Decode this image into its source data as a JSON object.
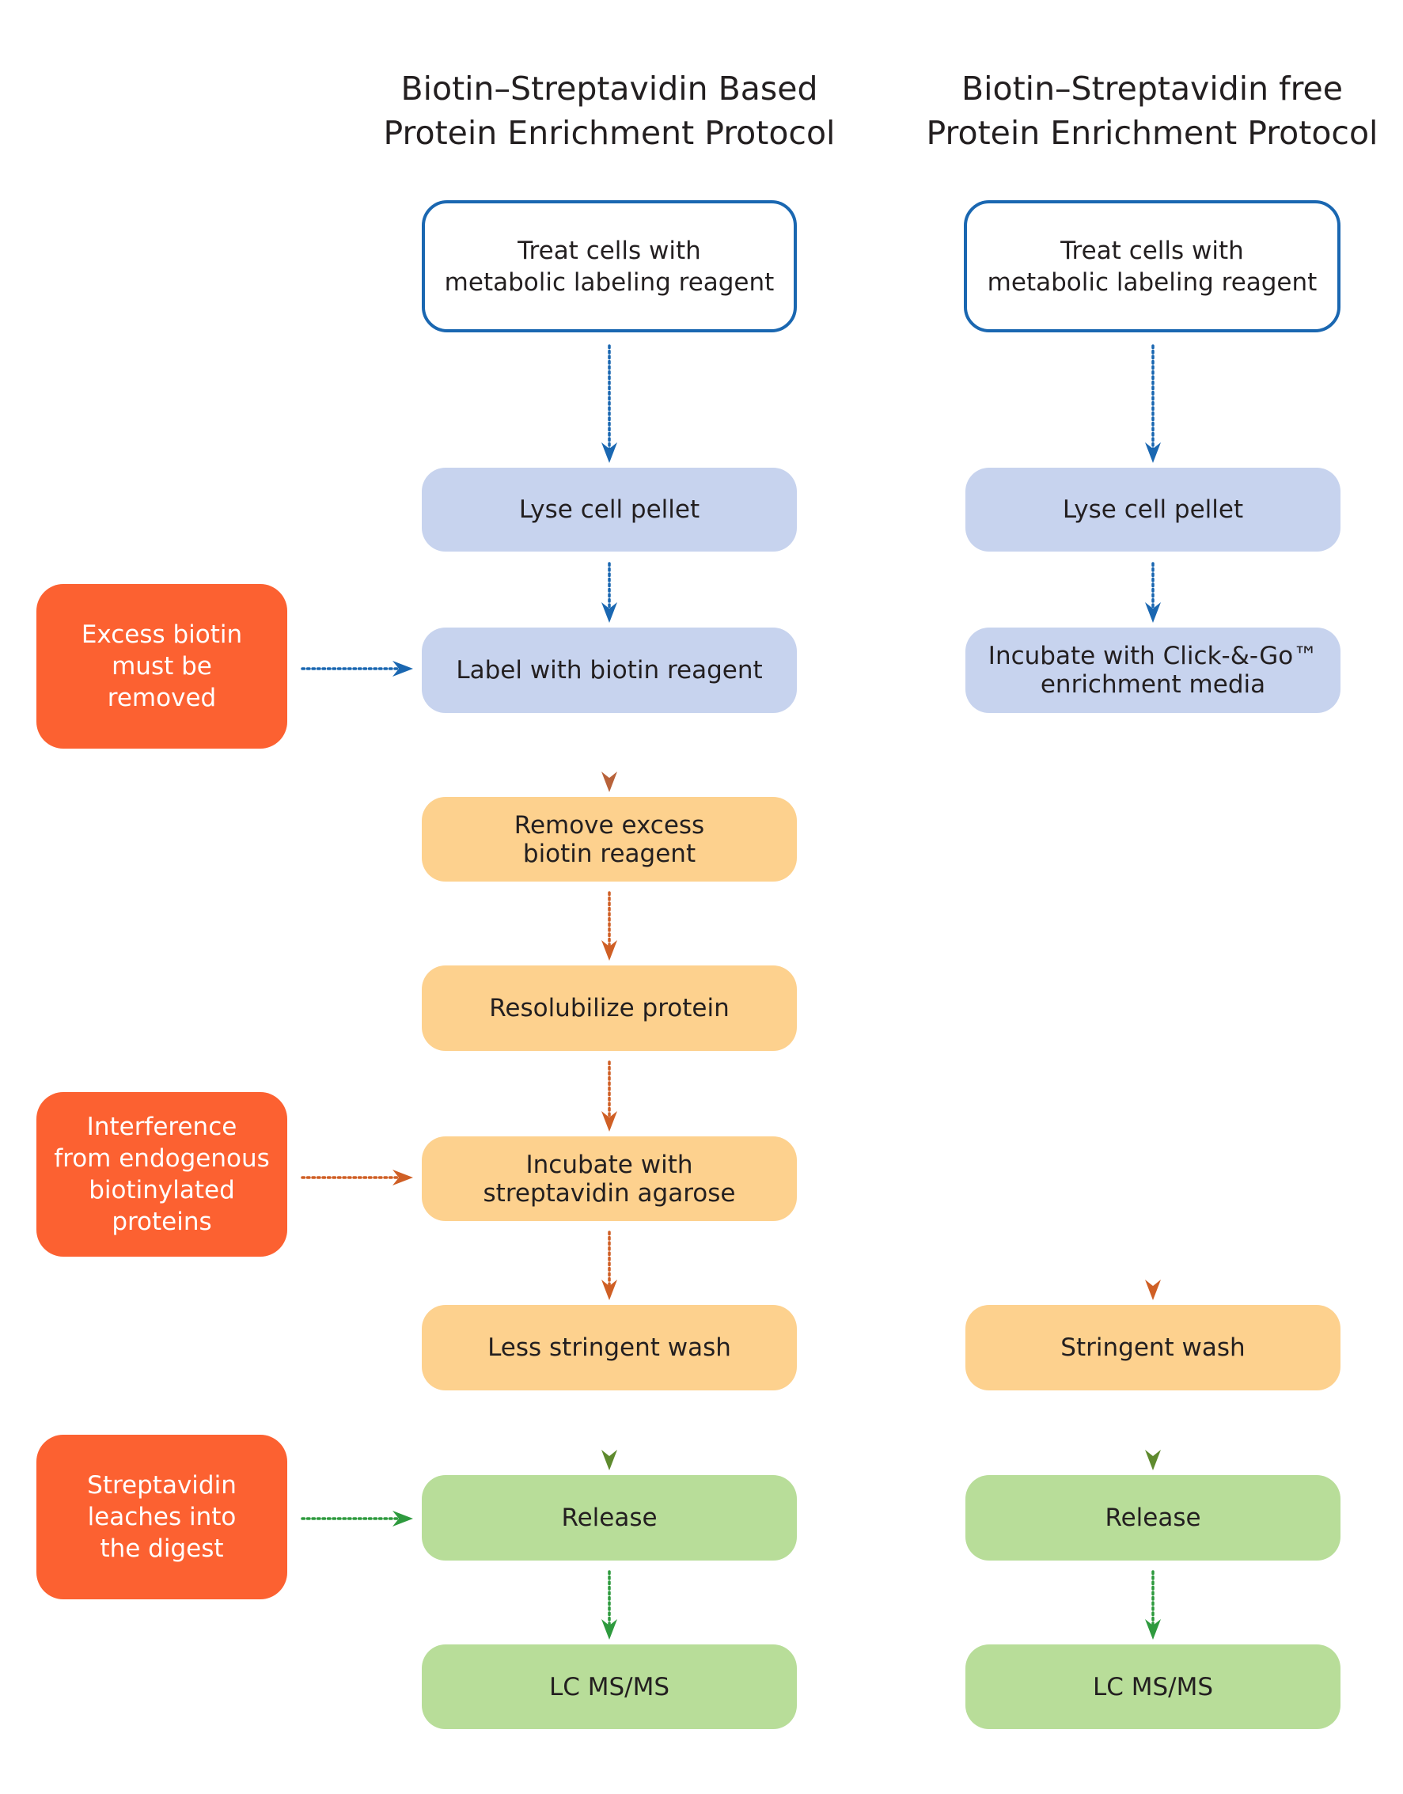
{
  "columns": [
    {
      "title": [
        "Biotin–Streptavidin Based",
        "Protein Enrichment Protocol"
      ],
      "steps": [
        {
          "lines": [
            "Treat cells with",
            "metabolic labeling reagent"
          ],
          "style": "outline"
        },
        {
          "lines": [
            "Lyse cell pellet"
          ],
          "style": "blue"
        },
        {
          "lines": [
            "Label with biotin reagent"
          ],
          "style": "blue"
        },
        {
          "lines": [
            "Remove excess",
            "biotin reagent"
          ],
          "style": "amber"
        },
        {
          "lines": [
            "Resolubilize protein"
          ],
          "style": "amber"
        },
        {
          "lines": [
            "Incubate with",
            "streptavidin agarose"
          ],
          "style": "amber"
        },
        {
          "lines": [
            "Less stringent wash"
          ],
          "style": "amber"
        },
        {
          "lines": [
            "Release"
          ],
          "style": "green"
        },
        {
          "lines": [
            "LC MS/MS"
          ],
          "style": "green"
        }
      ]
    },
    {
      "title": [
        "Biotin–Streptavidin free",
        "Protein Enrichment Protocol"
      ],
      "steps": [
        {
          "lines": [
            "Treat cells with",
            "metabolic labeling reagent"
          ],
          "style": "outline"
        },
        {
          "lines": [
            "Lyse cell pellet"
          ],
          "style": "blue"
        },
        {
          "lines": [
            "Incubate with Click-&-Go™",
            "enrichment media"
          ],
          "style": "blue"
        },
        {
          "lines": [
            "Stringent wash"
          ],
          "style": "amber"
        },
        {
          "lines": [
            "Release"
          ],
          "style": "green"
        },
        {
          "lines": [
            "LC MS/MS"
          ],
          "style": "green"
        }
      ]
    }
  ],
  "callouts": [
    {
      "lines": [
        "Excess biotin",
        "must  be",
        "removed"
      ],
      "points_to": "Label with biotin reagent",
      "arrow_color": "#1a67b1"
    },
    {
      "lines": [
        "Interference",
        "from endogenous",
        "biotinylated",
        "proteins"
      ],
      "points_to": "Incubate with streptavidin agarose",
      "arrow_color": "#cf5f25"
    },
    {
      "lines": [
        "Streptavidin",
        "leaches into",
        "the digest"
      ],
      "points_to": "Release",
      "arrow_color": "#2e9a3e"
    }
  ],
  "colors": {
    "outline_border": "#1a67b1",
    "blue_step": "#c7d3ee",
    "amber_step": "#fdd18e",
    "green_step": "#b8dd99",
    "callout": "#fc6131",
    "arrow_blue": "#1a67b1",
    "arrow_orange": "#cf5f25",
    "arrow_green": "#2e9a3e"
  }
}
